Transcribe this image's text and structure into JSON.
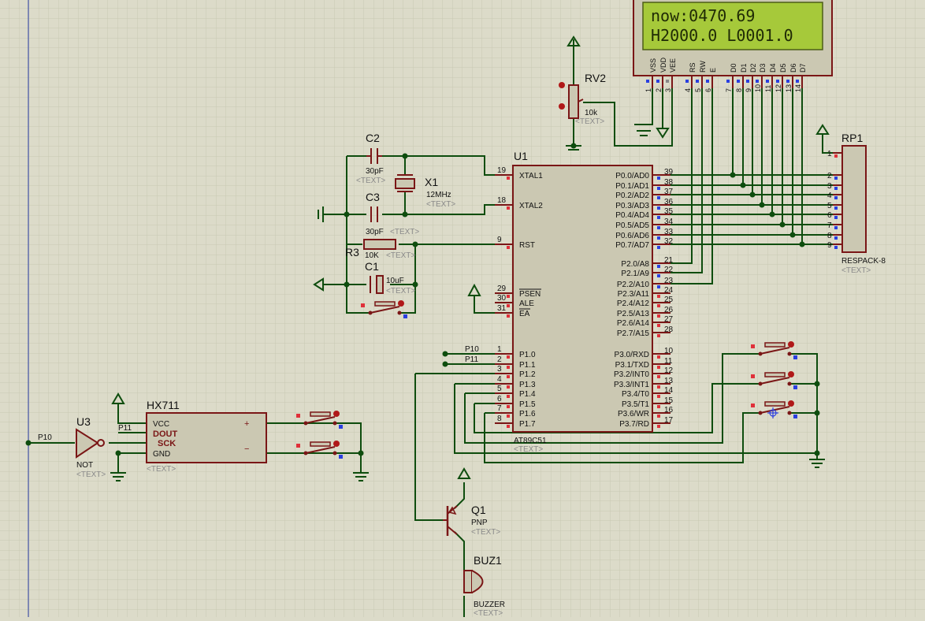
{
  "lcd": {
    "line1": "now:0470.69",
    "line2": "H2000.0 L0001.0",
    "pins": [
      {
        "name": "VSS",
        "num": "1"
      },
      {
        "name": "VDD",
        "num": "2"
      },
      {
        "name": "VEE",
        "num": "3"
      },
      {
        "name": "RS",
        "num": "4"
      },
      {
        "name": "RW",
        "num": "5"
      },
      {
        "name": "E",
        "num": "6"
      },
      {
        "name": "D0",
        "num": "7"
      },
      {
        "name": "D1",
        "num": "8"
      },
      {
        "name": "D2",
        "num": "9"
      },
      {
        "name": "D3",
        "num": "10"
      },
      {
        "name": "D4",
        "num": "11"
      },
      {
        "name": "D5",
        "num": "12"
      },
      {
        "name": "D6",
        "num": "13"
      },
      {
        "name": "D7",
        "num": "14"
      }
    ]
  },
  "rv2": {
    "ref": "RV2",
    "value": "10k",
    "text": "<TEXT>"
  },
  "c2": {
    "ref": "C2",
    "value": "30pF",
    "text": "<TEXT>"
  },
  "c3": {
    "ref": "C3",
    "value": "30pF",
    "text": "<TEXT>"
  },
  "x1": {
    "ref": "X1",
    "value": "12MHz",
    "text": "<TEXT>"
  },
  "r3": {
    "ref": "R3",
    "value": "10K",
    "text": "<TEXT>"
  },
  "c1": {
    "ref": "C1",
    "value": "10uF",
    "text": "<TEXT>"
  },
  "u1": {
    "ref": "U1",
    "part": "AT89C51",
    "text": "<TEXT>",
    "left_pins": [
      {
        "name": "XTAL1",
        "num": "19"
      },
      {
        "name": "XTAL2",
        "num": "18"
      },
      {
        "name": "RST",
        "num": "9"
      },
      {
        "name": "PSEN",
        "num": "29"
      },
      {
        "name": "ALE",
        "num": "30"
      },
      {
        "name": "EA",
        "num": "31"
      },
      {
        "name": "P1.0",
        "num": "1"
      },
      {
        "name": "P1.1",
        "num": "2"
      },
      {
        "name": "P1.2",
        "num": "3"
      },
      {
        "name": "P1.3",
        "num": "4"
      },
      {
        "name": "P1.4",
        "num": "5"
      },
      {
        "name": "P1.5",
        "num": "6"
      },
      {
        "name": "P1.6",
        "num": "7"
      },
      {
        "name": "P1.7",
        "num": "8"
      }
    ],
    "right_pins": [
      {
        "name": "P0.0/AD0",
        "num": "39"
      },
      {
        "name": "P0.1/AD1",
        "num": "38"
      },
      {
        "name": "P0.2/AD2",
        "num": "37"
      },
      {
        "name": "P0.3/AD3",
        "num": "36"
      },
      {
        "name": "P0.4/AD4",
        "num": "35"
      },
      {
        "name": "P0.5/AD5",
        "num": "34"
      },
      {
        "name": "P0.6/AD6",
        "num": "33"
      },
      {
        "name": "P0.7/AD7",
        "num": "32"
      },
      {
        "name": "P2.0/A8",
        "num": "21"
      },
      {
        "name": "P2.1/A9",
        "num": "22"
      },
      {
        "name": "P2.2/A10",
        "num": "23"
      },
      {
        "name": "P2.3/A11",
        "num": "24"
      },
      {
        "name": "P2.4/A12",
        "num": "25"
      },
      {
        "name": "P2.5/A13",
        "num": "26"
      },
      {
        "name": "P2.6/A14",
        "num": "27"
      },
      {
        "name": "P2.7/A15",
        "num": "28"
      },
      {
        "name": "P3.0/RXD",
        "num": "10"
      },
      {
        "name": "P3.1/TXD",
        "num": "11"
      },
      {
        "name": "P3.2/INT0",
        "num": "12"
      },
      {
        "name": "P3.3/INT1",
        "num": "13"
      },
      {
        "name": "P3.4/T0",
        "num": "14"
      },
      {
        "name": "P3.5/T1",
        "num": "15"
      },
      {
        "name": "P3.6/WR",
        "num": "16"
      },
      {
        "name": "P3.7/RD",
        "num": "17"
      }
    ]
  },
  "rp1": {
    "ref": "RP1",
    "part": "RESPACK-8",
    "text": "<TEXT>",
    "pins": [
      "1",
      "2",
      "3",
      "4",
      "5",
      "6",
      "7",
      "8",
      "9"
    ]
  },
  "hx711": {
    "ref": "HX711",
    "text": "<TEXT>",
    "pins": [
      "VCC",
      "DOUT",
      "SCK",
      "GND"
    ],
    "plus": "+",
    "minus": "−"
  },
  "u3": {
    "ref": "U3",
    "part": "NOT",
    "text": "<TEXT>"
  },
  "q1": {
    "ref": "Q1",
    "part": "PNP",
    "text": "<TEXT>"
  },
  "buz1": {
    "ref": "BUZ1",
    "part": "BUZZER",
    "text": "<TEXT>"
  },
  "nets": {
    "p10": "P10",
    "p11": "P11"
  },
  "colors": {
    "background": "#dcdbc9",
    "grid": "#c9c8b3",
    "wire": "#0e4d0e",
    "component": "#7a1616",
    "component_fill": "#cbc8b2",
    "lcd_screen": "#a6c93a",
    "lcd_text": "#1f2a05",
    "pin_red": "#e0303a",
    "pin_blue": "#2a3fe0"
  }
}
